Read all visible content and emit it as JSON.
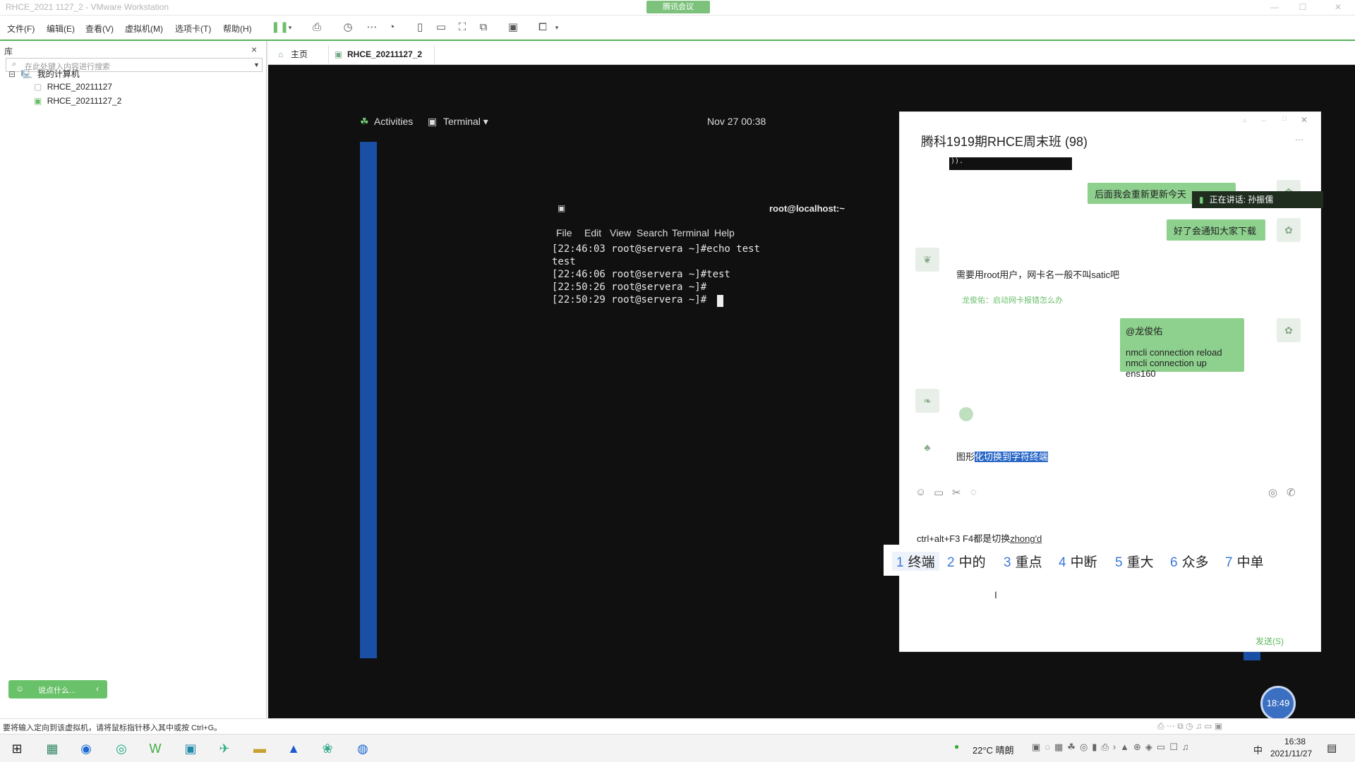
{
  "window": {
    "title": "RHCE_2021 1127_2 - VMware Workstation",
    "meeting_tag": "腾讯会议"
  },
  "menubar": {
    "items": [
      "文件(F)",
      "编辑(E)",
      "查看(V)",
      "虚拟机(M)",
      "选项卡(T)",
      "帮助(H)"
    ]
  },
  "library": {
    "label": "库",
    "close": "×",
    "search_placeholder": "在此处键入内容进行搜索",
    "tree": [
      {
        "label": "我的计算机",
        "expander": "⊟"
      },
      {
        "label": "RHCE_20211127"
      },
      {
        "label": "RHCE_20211127_2"
      }
    ],
    "chat_bubble": "说点什么..."
  },
  "tabs": [
    {
      "label": "主页"
    },
    {
      "label": "RHCE_20211127_2"
    }
  ],
  "vm": {
    "gnome": {
      "activities": "Activities",
      "app_menu": "Terminal ▾",
      "clock": "Nov 27  00:38"
    },
    "terminal": {
      "title": "root@localhost:~",
      "menu": [
        "File",
        "Edit",
        "View",
        "Search",
        "Terminal",
        "Help"
      ],
      "lines": [
        "[22:46:03 root@servera ~]#echo test",
        "test",
        "[22:46:06 root@servera ~]#test",
        "[22:50:26 root@servera ~]#",
        "[22:50:29 root@servera ~]#"
      ]
    }
  },
  "qq": {
    "title": "腾科1919期RHCE周末班 (98)",
    "top_snippet": ")).",
    "msg1": "后面我会重新更新今天",
    "speaking": "正在讲话: 孙振儒",
    "msg2": "好了会通知大家下载",
    "msg3": "需要用root用户，网卡名一般不叫satic吧",
    "quote": "龙俊佑：启动网卡报错怎么办",
    "reply_at": "@龙俊佑",
    "reply_l1": "nmcli connection reload",
    "reply_l2": "nmcli connection up ens160",
    "msg4_prefix": "图形",
    "msg4_sel": "化切换到字符终端",
    "input_text": "ctrl+alt+F3 F4都是切换",
    "ime_comp": "zhong'd",
    "send": "发送(S)",
    "timer": "18:49",
    "candidates": [
      {
        "n": "1",
        "w": "终端"
      },
      {
        "n": "2",
        "w": "中的"
      },
      {
        "n": "3",
        "w": "重点"
      },
      {
        "n": "4",
        "w": "中断"
      },
      {
        "n": "5",
        "w": "重大"
      },
      {
        "n": "6",
        "w": "众多"
      },
      {
        "n": "7",
        "w": "中单"
      }
    ]
  },
  "statusbar": {
    "hint": "要将输入定向到该虚拟机，请将鼠标指针移入其中或按 Ctrl+G。"
  },
  "taskbar": {
    "weather": "22°C  晴朗",
    "ime": "中",
    "time": "16:38",
    "date": "2021/11/27"
  }
}
